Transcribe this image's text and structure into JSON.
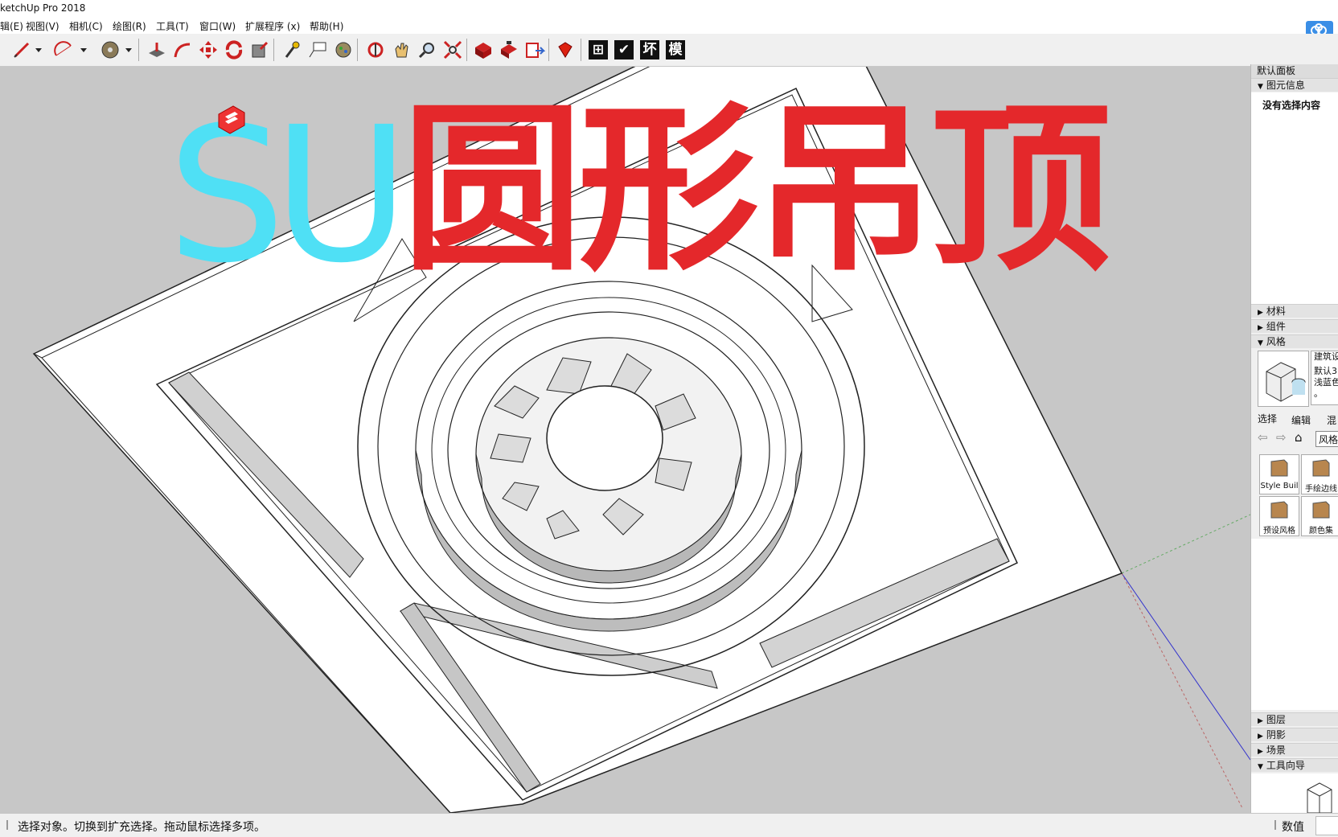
{
  "window": {
    "title": "ketchUp Pro 2018"
  },
  "menu": [
    "辑(E)",
    "视图(V)",
    "相机(C)",
    "绘图(R)",
    "工具(T)",
    "窗口(W)",
    "扩展程序 (x)",
    "帮助(H)"
  ],
  "toolbar": {
    "icons": [
      "pencil-icon",
      "dropdown-icon",
      "arc-icon",
      "dropdown-icon",
      "paint-bucket-icon",
      "dropdown-icon",
      "push-pull-icon",
      "follow-me-icon",
      "move-icon",
      "rotate-icon",
      "scale-icon",
      "tape-measure-icon",
      "text-icon",
      "paint-icon",
      "orbit-icon",
      "pan-icon",
      "zoom-icon",
      "zoom-extents-icon",
      "warehouse-icon",
      "extension-warehouse-icon",
      "send-to-layout-icon",
      "ruby-icon"
    ],
    "big_buttons": [
      "⊞",
      "✔",
      "坏",
      "模"
    ]
  },
  "overlay": {
    "su": "SU",
    "title": "圆形吊顶"
  },
  "tray": {
    "title": "默认面板",
    "entity_info": {
      "header": "图元信息",
      "empty": "没有选择内容"
    },
    "sections": [
      "材料",
      "组件"
    ],
    "styles": {
      "header": "风格",
      "style_name": "建筑设",
      "style_desc_1": "默认3",
      "style_desc_2": "浅蓝色",
      "style_desc_3": "。",
      "tabs": [
        "选择",
        "编辑",
        "混"
      ],
      "search": "风格",
      "items": [
        "Style Buil",
        "手绘边线",
        "预设风格",
        "颜色集"
      ]
    },
    "bottom_sections": [
      "图层",
      "阴影",
      "场景",
      "工具向导"
    ]
  },
  "status": {
    "message": "选择对象。切换到扩充选择。拖动鼠标选择多项。",
    "value_label": "数值"
  },
  "colors": {
    "su_cyan": "#4fe0f5",
    "title_red": "#e4282b",
    "viewport_bg": "#c7c7c7"
  }
}
